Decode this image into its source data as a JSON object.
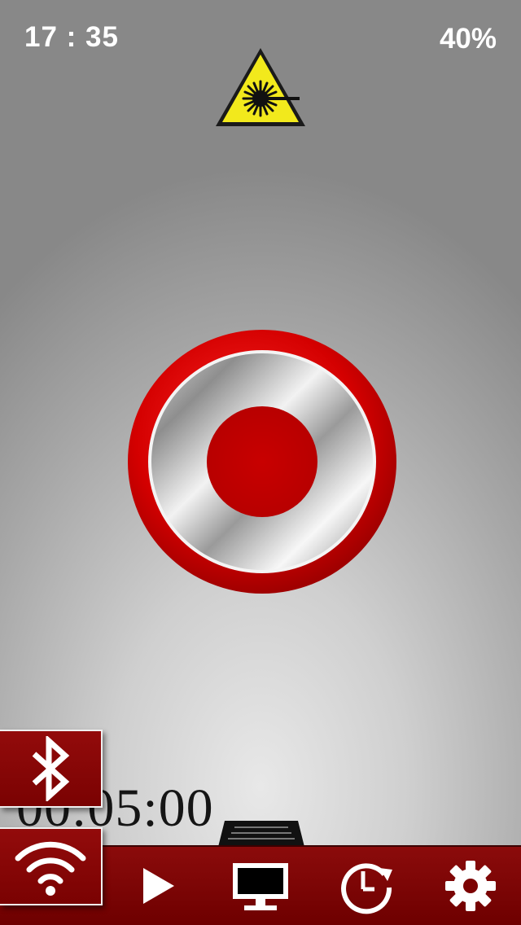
{
  "status_bar": {
    "time": "17 : 35",
    "battery": "40%"
  },
  "warning": {
    "icon": "laser-warning-icon",
    "color": "#f2e91c"
  },
  "record_button": {
    "icon": "record-icon",
    "ring_color": "#d20000",
    "center_color": "#c00000"
  },
  "timer": {
    "value": "00:05:00"
  },
  "side_buttons": [
    {
      "name": "bluetooth",
      "icon": "bluetooth-icon"
    },
    {
      "name": "wifi",
      "icon": "wifi-icon"
    }
  ],
  "toolbar": {
    "background": "#850404",
    "items": [
      {
        "name": "play",
        "icon": "play-icon"
      },
      {
        "name": "display",
        "icon": "monitor-icon"
      },
      {
        "name": "timer",
        "icon": "timer-icon"
      },
      {
        "name": "settings",
        "icon": "gear-icon"
      }
    ]
  }
}
